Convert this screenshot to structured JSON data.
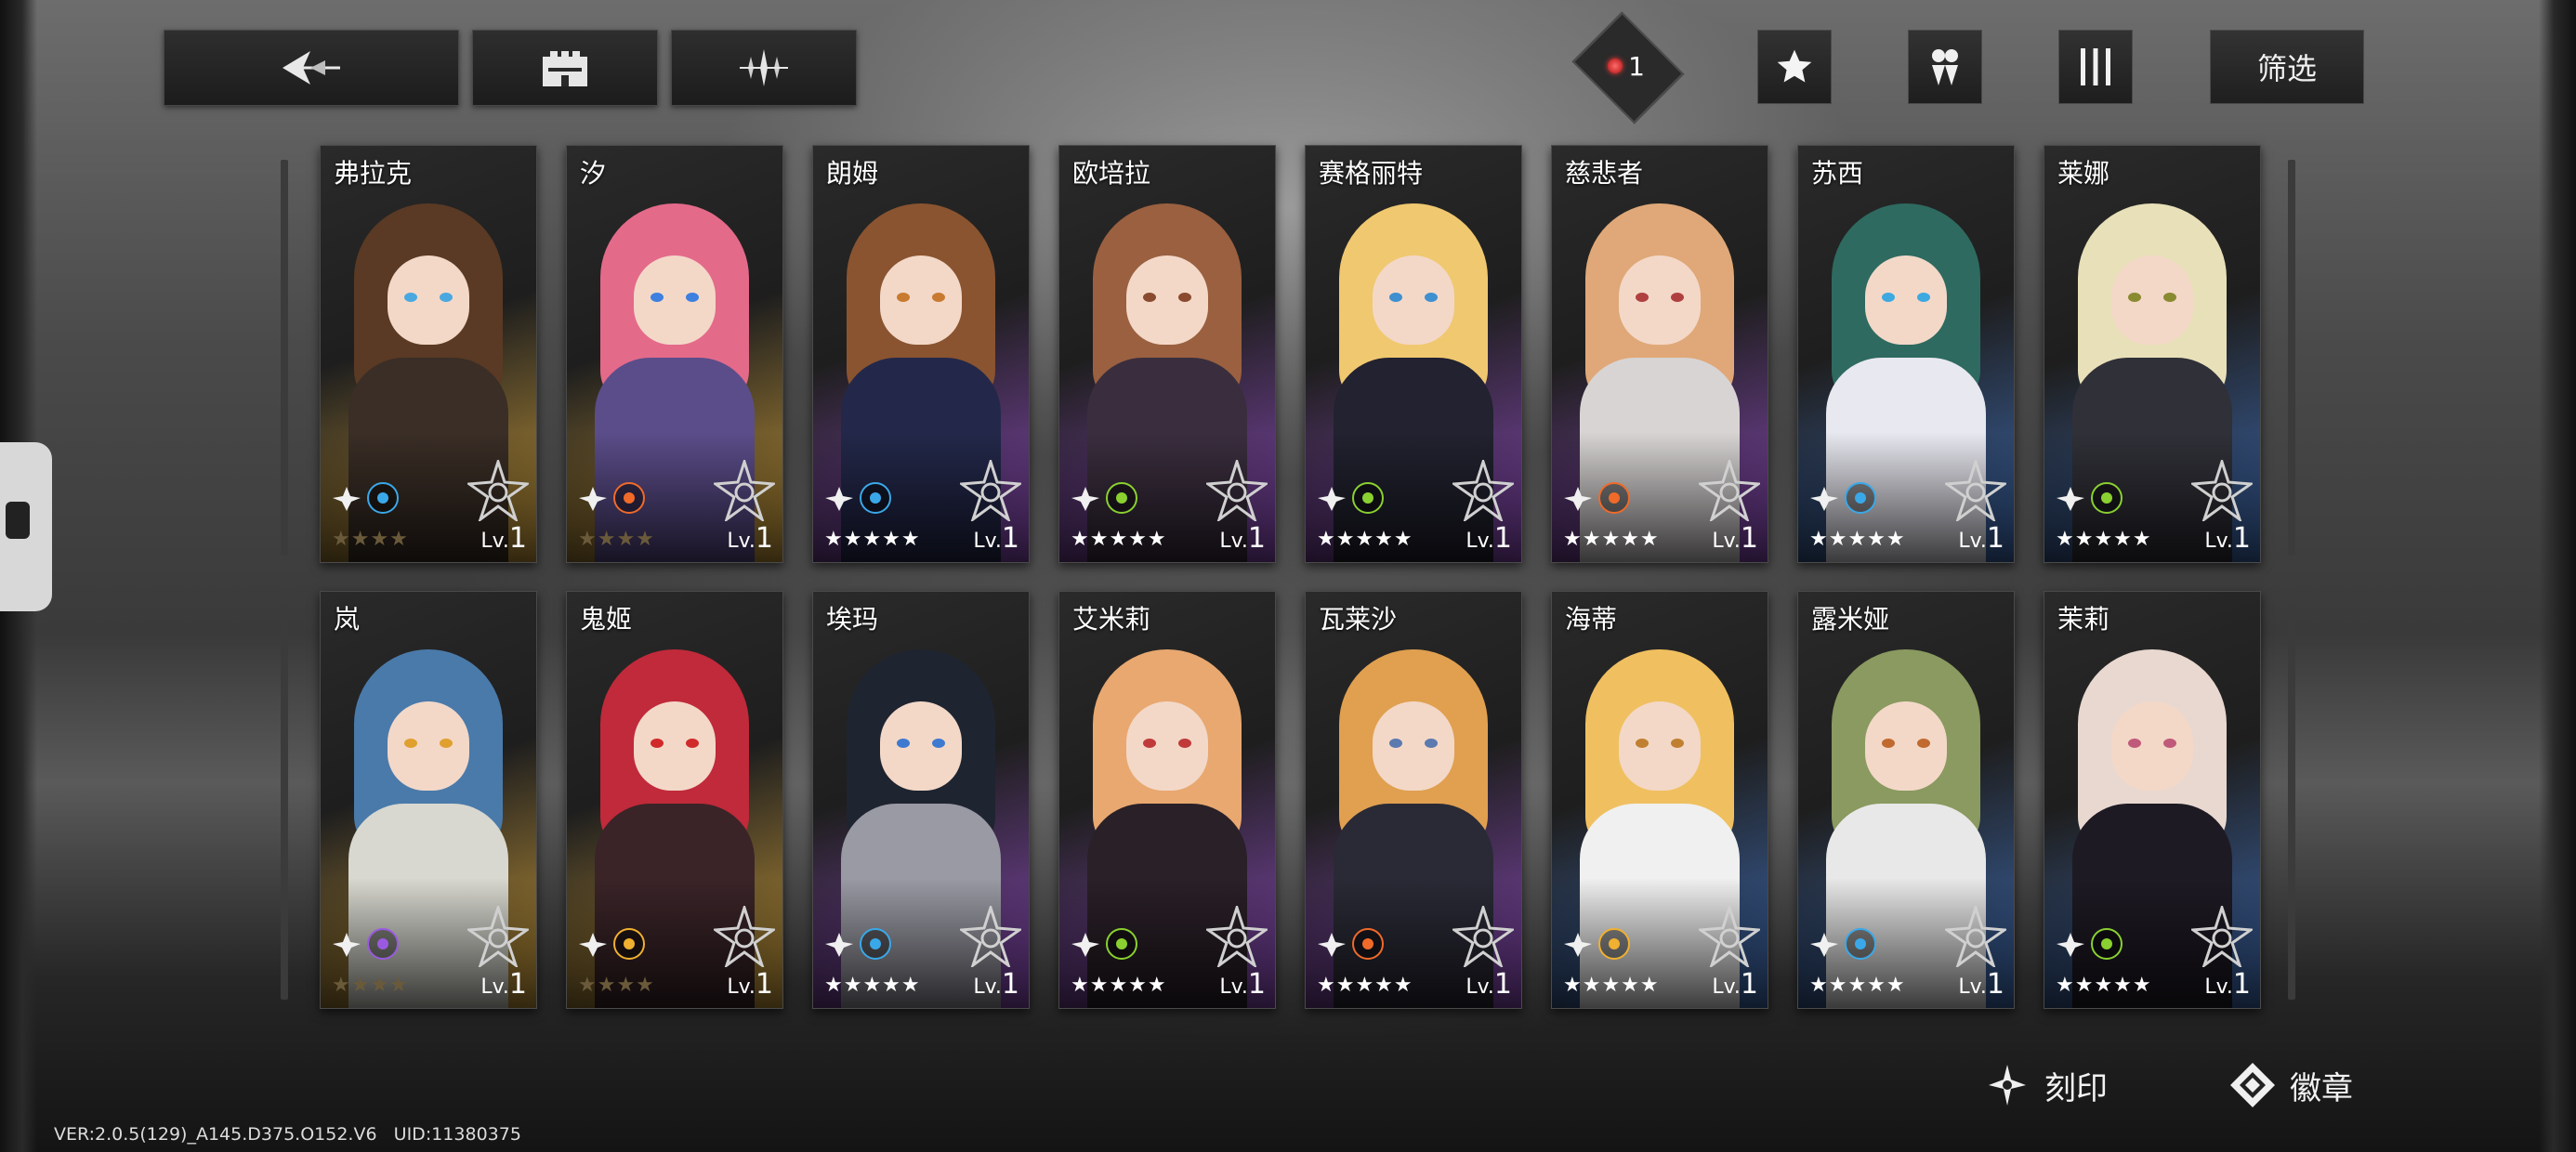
{
  "toolbar": {
    "back_icon": "back-arrow-icon",
    "castle_icon": "castle-icon",
    "sparkle_icon": "sparkle-icon"
  },
  "header": {
    "badge_count": "1",
    "star_icon": "star-icon",
    "team_icon": "team-icon",
    "columns_icon": "columns-icon",
    "filter_label": "筛选"
  },
  "cards": [
    {
      "name": "弗拉克",
      "stars": "★★★★",
      "level_prefix": "Lv.",
      "level": "1",
      "rarity": "gold",
      "element": "water",
      "hair": "#5a3a24",
      "dress": "#3a2e26",
      "eye": "#4aa8e0"
    },
    {
      "name": "汐",
      "stars": "★★★★",
      "level_prefix": "Lv.",
      "level": "1",
      "rarity": "gold",
      "element": "fire",
      "hair": "#e46a8a",
      "dress": "#5b4d8a",
      "eye": "#3e7fe0"
    },
    {
      "name": "朗姆",
      "stars": "★★★★★",
      "level_prefix": "Lv.",
      "level": "1",
      "rarity": "purple",
      "element": "water",
      "hair": "#8a5430",
      "dress": "#23284a",
      "eye": "#c87a30"
    },
    {
      "name": "欧培拉",
      "stars": "★★★★★",
      "level_prefix": "Lv.",
      "level": "1",
      "rarity": "purple",
      "element": "nature",
      "hair": "#9a6040",
      "dress": "#3a2e3e",
      "eye": "#8a4a30"
    },
    {
      "name": "赛格丽特",
      "stars": "★★★★★",
      "level_prefix": "Lv.",
      "level": "1",
      "rarity": "purple",
      "element": "nature",
      "hair": "#f0c870",
      "dress": "#222230",
      "eye": "#3e90d0"
    },
    {
      "name": "慈悲者",
      "stars": "★★★★★",
      "level_prefix": "Lv.",
      "level": "1",
      "rarity": "purple",
      "element": "fire",
      "hair": "#e0a878",
      "dress": "#d8d4d4",
      "eye": "#b04040"
    },
    {
      "name": "苏西",
      "stars": "★★★★★",
      "level_prefix": "Lv.",
      "level": "1",
      "rarity": "blue",
      "element": "water",
      "hair": "#2e6a60",
      "dress": "#e8e8f0",
      "eye": "#3ea8e0"
    },
    {
      "name": "莱娜",
      "stars": "★★★★★",
      "level_prefix": "Lv.",
      "level": "1",
      "rarity": "blue",
      "element": "nature",
      "hair": "#e8e0b8",
      "dress": "#303038",
      "eye": "#8a8a30"
    },
    {
      "name": "岚",
      "stars": "★★★★",
      "level_prefix": "Lv.",
      "level": "1",
      "rarity": "gold",
      "element": "arcane",
      "hair": "#4a7aaa",
      "dress": "#d8d8d0",
      "eye": "#e0a030"
    },
    {
      "name": "鬼姬",
      "stars": "★★★★",
      "level_prefix": "Lv.",
      "level": "1",
      "rarity": "gold",
      "element": "light",
      "hair": "#c02a3a",
      "dress": "#3a2428",
      "eye": "#d02a2a"
    },
    {
      "name": "埃玛",
      "stars": "★★★★★",
      "level_prefix": "Lv.",
      "level": "1",
      "rarity": "purple",
      "element": "water",
      "hair": "#1e2430",
      "dress": "#9a9aa4",
      "eye": "#3e7ad0"
    },
    {
      "name": "艾米莉",
      "stars": "★★★★★",
      "level_prefix": "Lv.",
      "level": "1",
      "rarity": "purple",
      "element": "nature",
      "hair": "#e8a870",
      "dress": "#2a2028",
      "eye": "#c03a3a"
    },
    {
      "name": "瓦莱沙",
      "stars": "★★★★★",
      "level_prefix": "Lv.",
      "level": "1",
      "rarity": "purple",
      "element": "fire",
      "hair": "#e0a050",
      "dress": "#2a2a36",
      "eye": "#5a7ab0"
    },
    {
      "name": "海蒂",
      "stars": "★★★★★",
      "level_prefix": "Lv.",
      "level": "1",
      "rarity": "blue",
      "element": "light",
      "hair": "#f0c060",
      "dress": "#f0f0f0",
      "eye": "#c08030"
    },
    {
      "name": "露米娅",
      "stars": "★★★★★",
      "level_prefix": "Lv.",
      "level": "1",
      "rarity": "blue",
      "element": "water",
      "hair": "#8a9a60",
      "dress": "#e8e8e8",
      "eye": "#c06a30"
    },
    {
      "name": "茉莉",
      "stars": "★★★★★",
      "level_prefix": "Lv.",
      "level": "1",
      "rarity": "blue",
      "element": "nature",
      "hair": "#e8d8d0",
      "dress": "#1e1a24",
      "eye": "#c05a7a"
    }
  ],
  "colors": {
    "gold": "#c89a3a",
    "purple": "#8a4ab8",
    "blue": "#3e6ab0",
    "water": "#3aa8e8",
    "fire": "#f06a2a",
    "nature": "#8ad030",
    "arcane": "#9a5ae0",
    "light": "#f0b030",
    "star_active": "#ffffff",
    "star_gold_dim": "#6a5a3a"
  },
  "actions": {
    "engrave_label": "刻印",
    "engrave_icon": "engrave-icon",
    "badge_label": "徽章",
    "badge_icon": "badge-icon"
  },
  "footer": {
    "version": "VER:2.0.5(129)_A145.D375.O152.V6",
    "uid": "UID:11380375"
  }
}
